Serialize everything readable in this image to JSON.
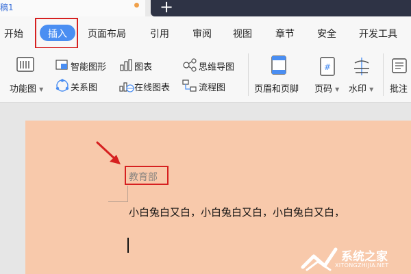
{
  "window": {
    "doc_tab_label": "稿1",
    "new_tab_symbol": "+"
  },
  "menu": {
    "items": [
      "开始",
      "插入",
      "页面布局",
      "引用",
      "审阅",
      "视图",
      "章节",
      "安全",
      "开发工具"
    ],
    "active": "插入"
  },
  "ribbon": {
    "function_chart": "功能图",
    "smart_shape": "智能图形",
    "chart": "图表",
    "mind_map": "思维导图",
    "relation_chart": "关系图",
    "online_chart": "在线图表",
    "flowchart": "流程图",
    "header_footer": "页眉和页脚",
    "page_number": "页码",
    "watermark": "水印",
    "comment": "批注"
  },
  "document": {
    "comment_author": "教育部",
    "body_text": "小白兔白又白，小白兔白又白，小白兔白又白，"
  },
  "watermark": {
    "title": "系统之家",
    "subtitle": "XITONGZHIJIA.NET"
  },
  "colors": {
    "accent_blue": "#4a8ef2",
    "highlight_red": "#d62020",
    "page_background": "#f8c9ab",
    "tab_bar_dark": "#2e3345"
  }
}
